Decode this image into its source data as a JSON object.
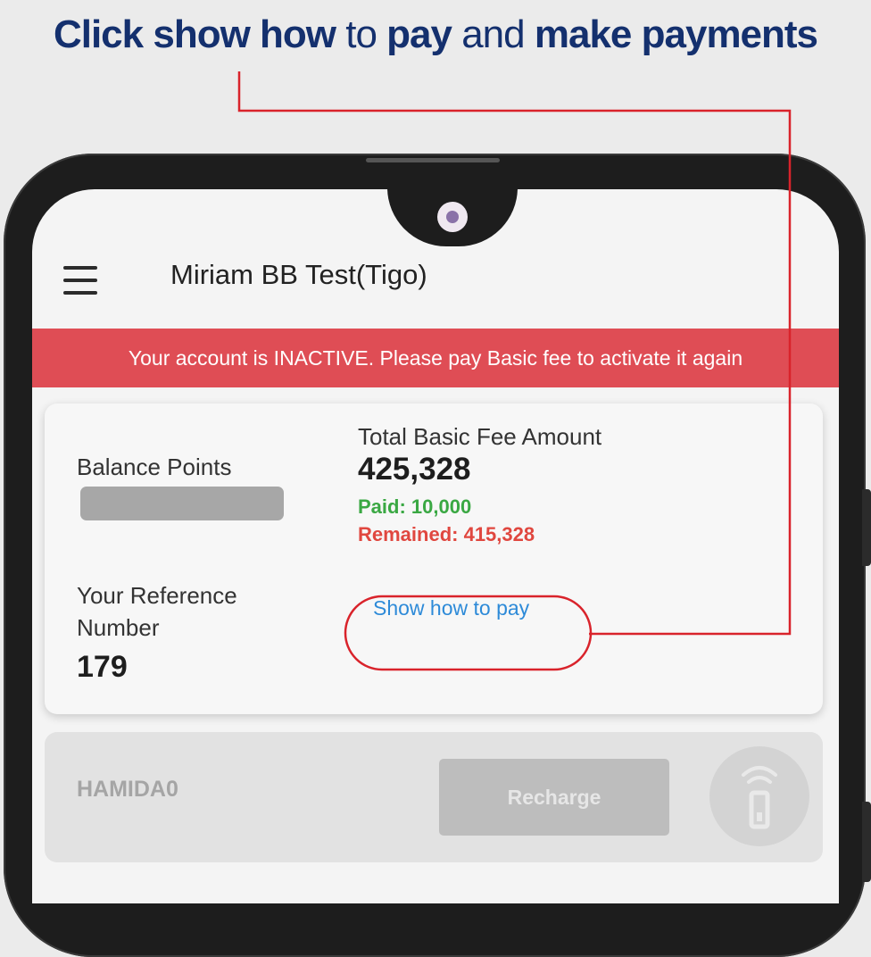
{
  "headline": {
    "part1": "Click show how",
    "part2": " to ",
    "part3": "pay",
    "part4": " and ",
    "part5": "make payments"
  },
  "app": {
    "title": "Miriam BB Test(Tigo)"
  },
  "banner": {
    "text": "Your account is INACTIVE. Please pay Basic fee to activate it again"
  },
  "account_card": {
    "balance_label": "Balance Points",
    "reference_label_line1": "Your Reference",
    "reference_label_line2": "Number",
    "reference_value": "179",
    "total_label": "Total Basic Fee Amount",
    "total_value": "425,328",
    "paid": "Paid: 10,000",
    "remained": "Remained: 415,328",
    "show_how_label": "Show how to pay"
  },
  "user_card": {
    "username": "HAMIDA0",
    "recharge_label": "Recharge"
  },
  "colors": {
    "headline": "#14306e",
    "banner": "#df4d55",
    "paid": "#3aa843",
    "remained": "#e0473f",
    "link": "#2d8ad8",
    "annotation": "#d9232b"
  },
  "icons": {
    "menu": "hamburger-menu-icon",
    "nfc": "contactless-card-icon"
  }
}
